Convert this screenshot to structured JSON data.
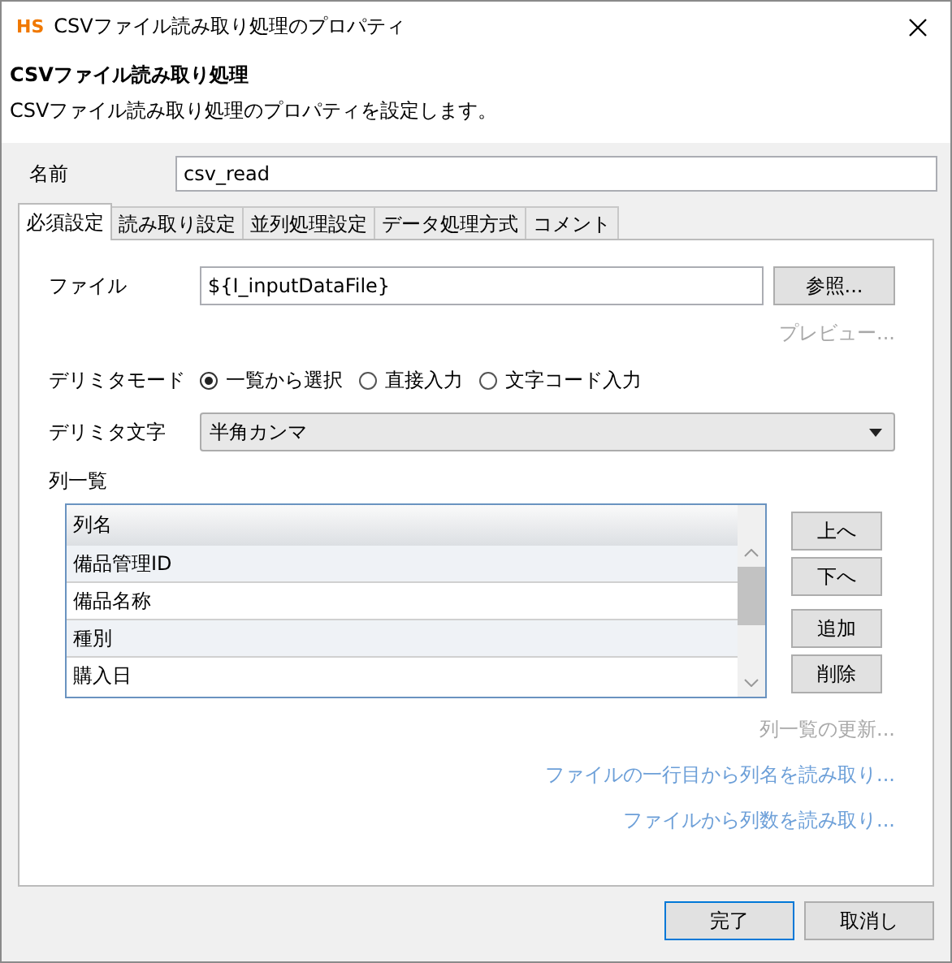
{
  "window": {
    "logo": "HS",
    "title": "CSVファイル読み取り処理のプロパティ"
  },
  "header": {
    "title": "CSVファイル読み取り処理",
    "description": "CSVファイル読み取り処理のプロパティを設定します。"
  },
  "name": {
    "label": "名前",
    "value": "csv_read"
  },
  "tabs": [
    {
      "label": "必須設定",
      "selected": true
    },
    {
      "label": "読み取り設定",
      "selected": false
    },
    {
      "label": "並列処理設定",
      "selected": false
    },
    {
      "label": "データ処理方式",
      "selected": false
    },
    {
      "label": "コメント",
      "selected": false
    }
  ],
  "file": {
    "label": "ファイル",
    "value": "${I_inputDataFile}",
    "button": "参照..."
  },
  "preview": {
    "label": "プレビュー...",
    "disabled": true
  },
  "delimiter_mode": {
    "label": "デリミタモード",
    "options": [
      {
        "label": "一覧から選択",
        "selected": true
      },
      {
        "label": "直接入力",
        "selected": false
      },
      {
        "label": "文字コード入力",
        "selected": false
      }
    ]
  },
  "delimiter_char": {
    "label": "デリミタ文字",
    "value": "半角カンマ"
  },
  "column_list": {
    "label": "列一覧",
    "header": "列名",
    "rows": [
      "備品管理ID",
      "備品名称",
      "種別",
      "購入日"
    ],
    "button_groups": [
      [
        "上へ",
        "下へ"
      ],
      [
        "追加",
        "削除"
      ]
    ]
  },
  "links": [
    {
      "label": "列一覧の更新...",
      "disabled": true
    },
    {
      "label": "ファイルの一行目から列名を読み取り...",
      "disabled": false
    },
    {
      "label": "ファイルから列数を読み取り...",
      "disabled": false
    }
  ],
  "buttons": [
    {
      "label": "完了",
      "default": true
    },
    {
      "label": "取消し",
      "default": false
    }
  ]
}
